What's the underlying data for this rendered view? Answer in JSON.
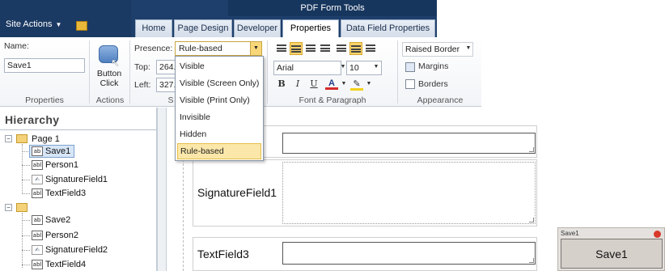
{
  "header": {
    "context_title": "PDF Form Tools",
    "site_actions": "Site Actions",
    "tabs": [
      "Home",
      "Page Design",
      "Developer",
      "Properties",
      "Data Field Properties"
    ]
  },
  "ribbon": {
    "properties": {
      "name_label": "Name:",
      "name_value": "Save1",
      "group_label": "Properties"
    },
    "actions": {
      "button_label": "Button Click",
      "group_label": "Actions"
    },
    "presence": {
      "label": "Presence:",
      "value": "Rule-based",
      "top_label": "Top:",
      "top_value": "264.",
      "left_label": "Left:",
      "left_value": "327.",
      "group_label_fragment": "S"
    },
    "font": {
      "family": "Arial",
      "size": "10",
      "bold": "B",
      "italic": "I",
      "underline": "U",
      "font_color": "A",
      "group_label": "Font & Paragraph"
    },
    "appearance": {
      "border_style": "Raised Border",
      "margins": "Margins",
      "borders": "Borders",
      "group_label": "Appearance"
    }
  },
  "presence_menu": {
    "items": [
      "Visible",
      "Visible (Screen Only)",
      "Visible (Print Only)",
      "Invisible",
      "Hidden",
      "Rule-based"
    ],
    "selected": "Rule-based"
  },
  "hierarchy": {
    "title": "Hierarchy",
    "page1": {
      "label": "Page 1",
      "items": [
        "Save1",
        "Person1",
        "SignatureField1",
        "TextField3"
      ]
    },
    "page2": {
      "label": "",
      "items": [
        "Save2",
        "Person2",
        "SignatureField2",
        "TextField4"
      ]
    },
    "icons": {
      "button": "ab",
      "field": "abl"
    }
  },
  "canvas": {
    "fields": [
      "SignatureField1",
      "TextField3"
    ]
  },
  "preview": {
    "title": "Save1",
    "button_text": "Save1"
  },
  "colors": {
    "ribbon_dark": "#1e3f6b",
    "selected_menu": "#fbe7a9",
    "active_toggle": "#fbd46a"
  }
}
